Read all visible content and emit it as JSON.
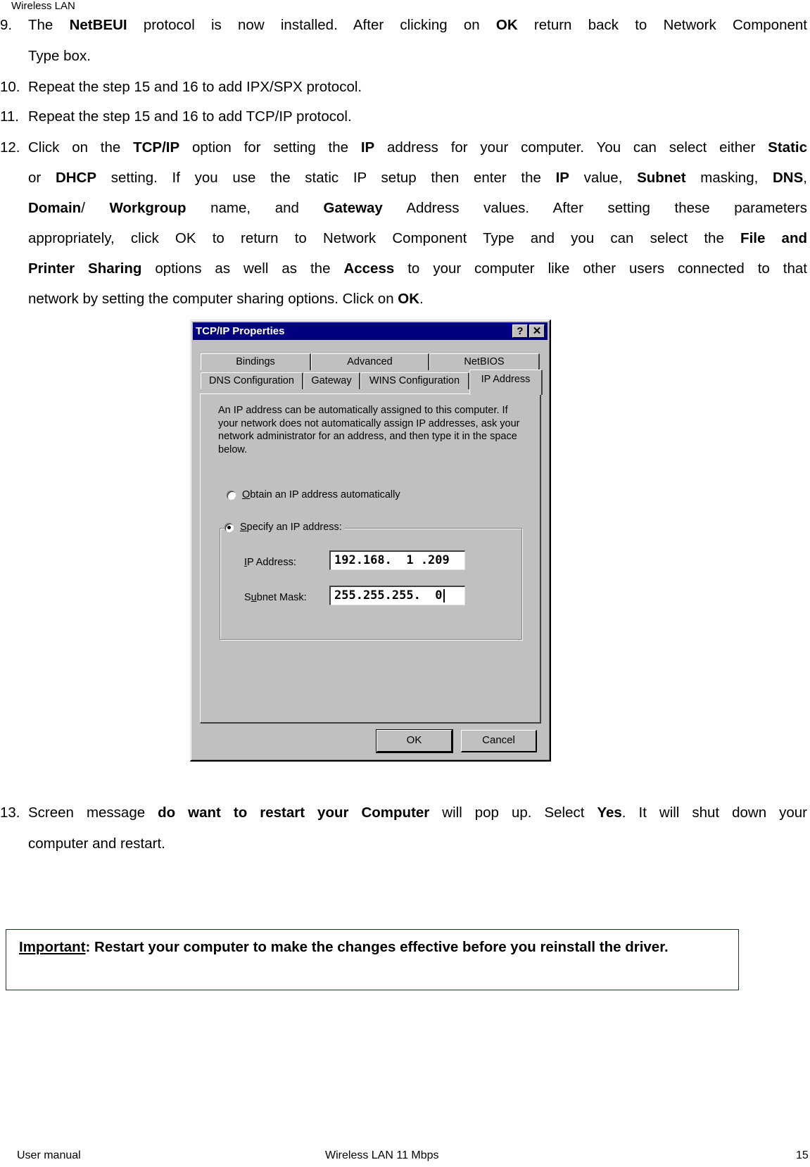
{
  "page": {
    "header": "Wireless LAN",
    "footer": {
      "left": "User manual",
      "center": "Wireless LAN 11 Mbps",
      "page_number": "15"
    }
  },
  "steps": {
    "s9": {
      "num": "9.",
      "line1": [
        {
          "t": "The ",
          "b": false
        },
        {
          "t": "NetBEUI",
          "b": true
        },
        {
          "t": " protocol is now installed. After clicking on ",
          "b": false
        },
        {
          "t": "OK",
          "b": true
        },
        {
          "t": " return back to Network Component",
          "b": false
        }
      ],
      "line2": "Type box."
    },
    "s10": {
      "num": "10.",
      "text": "Repeat the step 15 and 16 to add IPX/SPX protocol."
    },
    "s11": {
      "num": "11.",
      "text": "Repeat the step 15 and 16 to add TCP/IP protocol."
    },
    "s12": {
      "num": "12.",
      "lines": [
        [
          {
            "t": "Click on the ",
            "b": false
          },
          {
            "t": "TCP/IP",
            "b": true
          },
          {
            "t": " option for setting the ",
            "b": false
          },
          {
            "t": "IP",
            "b": true
          },
          {
            "t": " address for your computer. You can select either ",
            "b": false
          },
          {
            "t": "Static",
            "b": true
          }
        ],
        [
          {
            "t": "or ",
            "b": false
          },
          {
            "t": "DHCP",
            "b": true
          },
          {
            "t": " setting. If you use the static IP setup then enter the ",
            "b": false
          },
          {
            "t": "IP",
            "b": true
          },
          {
            "t": " value, ",
            "b": false
          },
          {
            "t": "Subnet",
            "b": true
          },
          {
            "t": " masking, ",
            "b": false
          },
          {
            "t": "DNS",
            "b": true
          },
          {
            "t": ",",
            "b": false
          }
        ],
        [
          {
            "t": "Domain",
            "b": true
          },
          {
            "t": "/ ",
            "b": false
          },
          {
            "t": "Workgroup",
            "b": true
          },
          {
            "t": " name, and ",
            "b": false
          },
          {
            "t": "Gateway",
            "b": true
          },
          {
            "t": " Address values. After setting these parameters",
            "b": false
          }
        ],
        [
          {
            "t": "appropriately, click OK to return to Network Component Type and you can select the ",
            "b": false
          },
          {
            "t": "File and",
            "b": true
          }
        ],
        [
          {
            "t": "Printer Sharing",
            "b": true
          },
          {
            "t": " options as well as the ",
            "b": false
          },
          {
            "t": "Access",
            "b": true
          },
          {
            "t": " to your computer like other users connected to that",
            "b": false
          }
        ],
        [
          {
            "t": "network by setting the computer sharing options. Click on ",
            "b": false
          },
          {
            "t": "OK",
            "b": true
          },
          {
            "t": ".",
            "b": false
          }
        ]
      ]
    },
    "s13": {
      "num": "13.",
      "line1": [
        {
          "t": "Screen message ",
          "b": false
        },
        {
          "t": "do want to restart your Computer",
          "b": true
        },
        {
          "t": " will pop up. Select ",
          "b": false
        },
        {
          "t": "Yes",
          "b": true
        },
        {
          "t": ". It will shut down your",
          "b": false
        }
      ],
      "line2": "computer and restart."
    }
  },
  "dialog": {
    "title": "TCP/IP Properties",
    "help_button": "?",
    "close_button": "✕",
    "tabs_row1": [
      "Bindings",
      "Advanced",
      "NetBIOS"
    ],
    "tabs_row2": [
      "DNS Configuration",
      "Gateway",
      "WINS Configuration",
      "IP Address"
    ],
    "active_tab": "IP Address",
    "description": "An IP address can be automatically assigned to this computer. If your network does not automatically assign IP addresses, ask your network administrator for an address, and then type it in the space below.",
    "radio_auto": {
      "mnemonic": "O",
      "rest": "btain an IP address automatically",
      "checked": false
    },
    "radio_specify": {
      "mnemonic": "S",
      "rest": "pecify an IP address:",
      "checked": true
    },
    "ip_label": {
      "mnemonic": "I",
      "rest": "P Address:"
    },
    "ip_value": "192.168.  1 .209",
    "subnet_label": {
      "pre": "S",
      "mnemonic": "u",
      "rest": "bnet Mask:"
    },
    "subnet_value": "255.255.255.  0",
    "ok_label": "OK",
    "cancel_label": "Cancel"
  },
  "important": {
    "label": "Important",
    "text": ": Restart your computer to make the changes effective before you reinstall the driver."
  }
}
